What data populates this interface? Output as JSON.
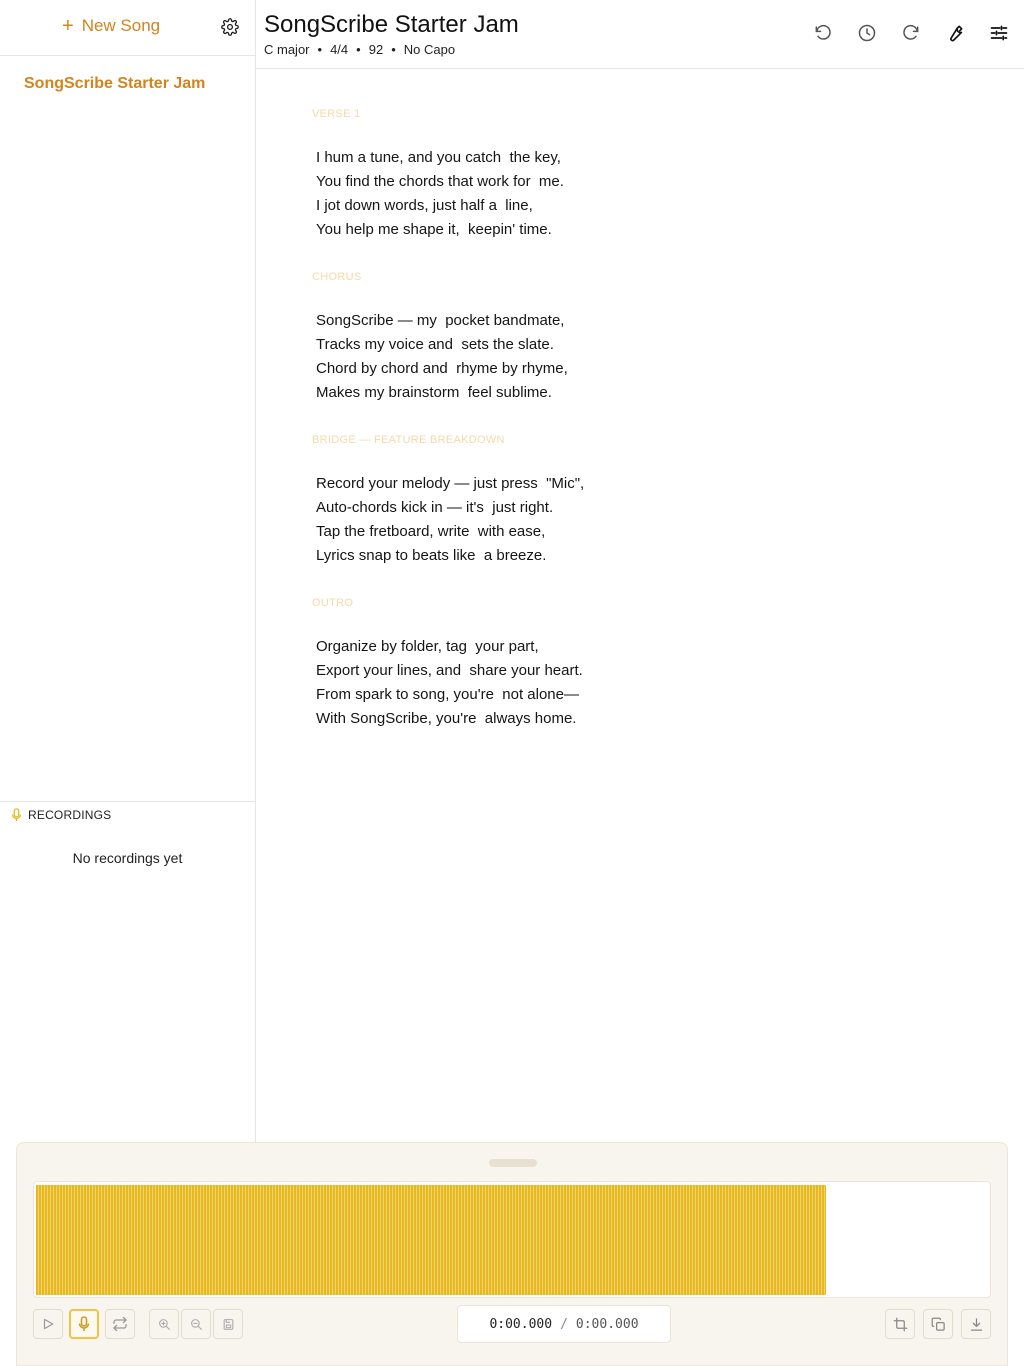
{
  "sidebar": {
    "new_song_label": "New Song",
    "songs": [
      {
        "title": "SongScribe Starter Jam"
      }
    ],
    "recordings_label": "RECORDINGS",
    "recordings_empty": "No recordings yet"
  },
  "header": {
    "title": "SongScribe Starter Jam",
    "meta": {
      "key": "C major",
      "time_signature": "4/4",
      "tempo": "92",
      "capo": "No Capo",
      "separator": "•"
    },
    "tools": [
      "undo-icon",
      "history-icon",
      "redo-icon",
      "wrench-icon",
      "sliders-icon"
    ]
  },
  "lyrics": {
    "sections": [
      {
        "label": "VERSE 1",
        "lines": [
          "I hum a tune, and you catch  the key,",
          "You find the chords that work for  me.",
          "I jot down words, just half a  line,",
          "You help me shape it,  keepin' time."
        ]
      },
      {
        "label": "CHORUS",
        "lines": [
          "SongScribe — my  pocket bandmate,",
          "Tracks my voice and  sets the slate.",
          "Chord by chord and  rhyme by rhyme,",
          "Makes my brainstorm  feel sublime."
        ]
      },
      {
        "label": "BRIDGE — FEATURE BREAKDOWN",
        "lines": [
          "Record your melody — just press  \"Mic\",",
          "Auto-chords kick in — it's  just right.",
          "Tap the fretboard, write  with ease,",
          "Lyrics snap to beats like  a breeze."
        ]
      },
      {
        "label": "OUTRO",
        "lines": [
          "Organize by folder, tag  your part,",
          "Export your lines, and  share your heart.",
          "From spark to song, you're  not alone—",
          "With SongScribe, you're  always home."
        ]
      }
    ]
  },
  "player": {
    "current_time": "0:00.000",
    "separator": "/",
    "total_time": "0:00.000",
    "waveform_fill": 0.83,
    "buttons": [
      "play-icon",
      "mic-icon",
      "loop-icon",
      "zoom-in-icon",
      "zoom-out-icon",
      "save-icon",
      "crop-icon",
      "copy-icon",
      "download-icon"
    ]
  },
  "colors": {
    "accent": "#d4841c",
    "waveform": "#e6b822",
    "section_label": "#f5d9a8",
    "panel_bg": "#f8f5ee"
  }
}
